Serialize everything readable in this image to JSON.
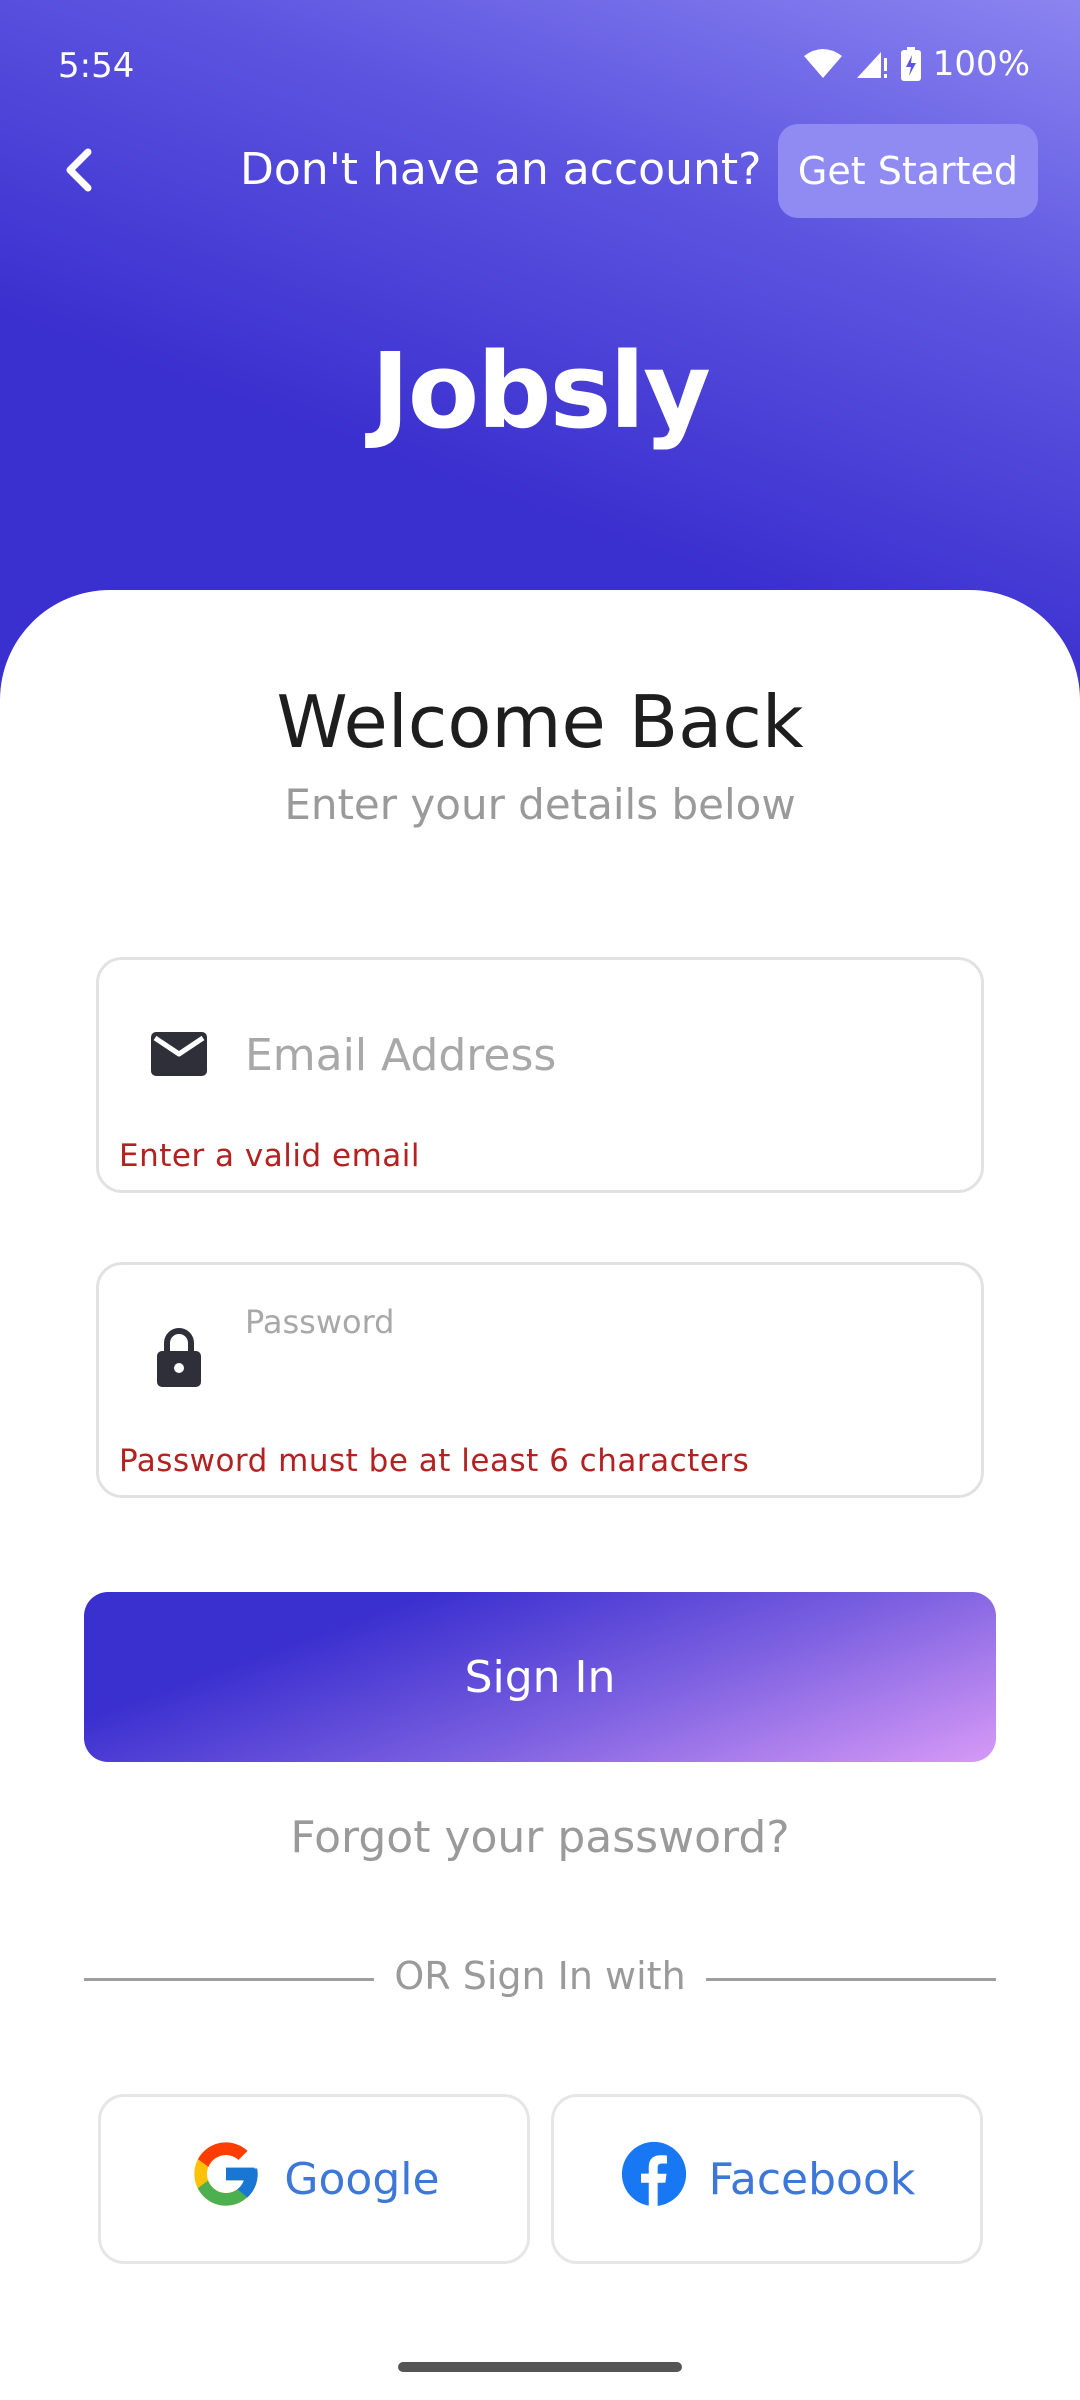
{
  "status_bar": {
    "time": "5:54",
    "battery": "100%"
  },
  "header": {
    "prompt": "Don't have an account?",
    "get_started_label": "Get Started",
    "brand": "Jobsly"
  },
  "main": {
    "title": "Welcome Back",
    "subtitle": "Enter your details below"
  },
  "form": {
    "email": {
      "placeholder": "Email Address",
      "value": "",
      "error": "Enter a valid email"
    },
    "password": {
      "label": "Password",
      "value": "",
      "error": "Password must be at least 6 characters"
    },
    "signin_label": "Sign In",
    "forgot_label": "Forgot your password?"
  },
  "social": {
    "divider_text": "OR Sign In with",
    "google_label": "Google",
    "facebook_label": "Facebook"
  },
  "colors": {
    "brand_primary": "#3a2fcf",
    "error": "#b32121",
    "link_blue": "#3d78d8"
  },
  "icons": [
    "back-icon",
    "wifi-icon",
    "signal-icon",
    "battery-icon",
    "mail-icon",
    "lock-icon",
    "google-icon",
    "facebook-icon"
  ]
}
